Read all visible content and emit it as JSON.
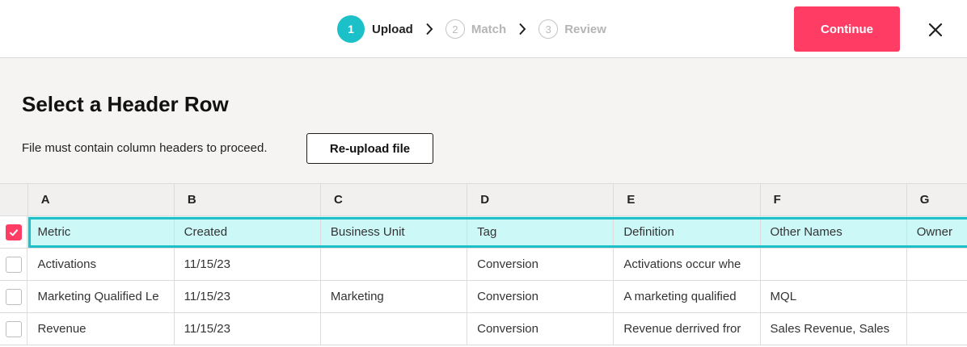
{
  "stepper": {
    "steps": [
      {
        "number": "1",
        "label": "Upload"
      },
      {
        "number": "2",
        "label": "Match"
      },
      {
        "number": "3",
        "label": "Review"
      }
    ]
  },
  "actions": {
    "continue_label": "Continue",
    "reupload_label": "Re-upload file"
  },
  "page": {
    "title": "Select a Header Row",
    "hint": "File must contain column headers to proceed."
  },
  "grid": {
    "columns": [
      "A",
      "B",
      "C",
      "D",
      "E",
      "F",
      "G"
    ],
    "rows": [
      {
        "checked": true,
        "cells": [
          "Metric",
          "Created",
          "Business Unit",
          "Tag",
          "Definition",
          "Other Names",
          "Owner"
        ]
      },
      {
        "checked": false,
        "cells": [
          "Activations",
          "11/15/23",
          "",
          "Conversion",
          "Activations occur whe",
          "",
          ""
        ]
      },
      {
        "checked": false,
        "cells": [
          "Marketing Qualified Le",
          "11/15/23",
          "Marketing",
          "Conversion",
          "A marketing qualified",
          "MQL",
          ""
        ]
      },
      {
        "checked": false,
        "cells": [
          "Revenue",
          "11/15/23",
          "",
          "Conversion",
          "Revenue derrived fror",
          "Sales Revenue, Sales",
          ""
        ]
      }
    ]
  },
  "colors": {
    "accent": "#ff3d64",
    "teal": "#1bc0c9",
    "selected_row": "#ccf8f7"
  },
  "icons": {
    "step_separator": "chevron-right-icon",
    "close": "close-icon",
    "checkbox": "check-icon"
  }
}
